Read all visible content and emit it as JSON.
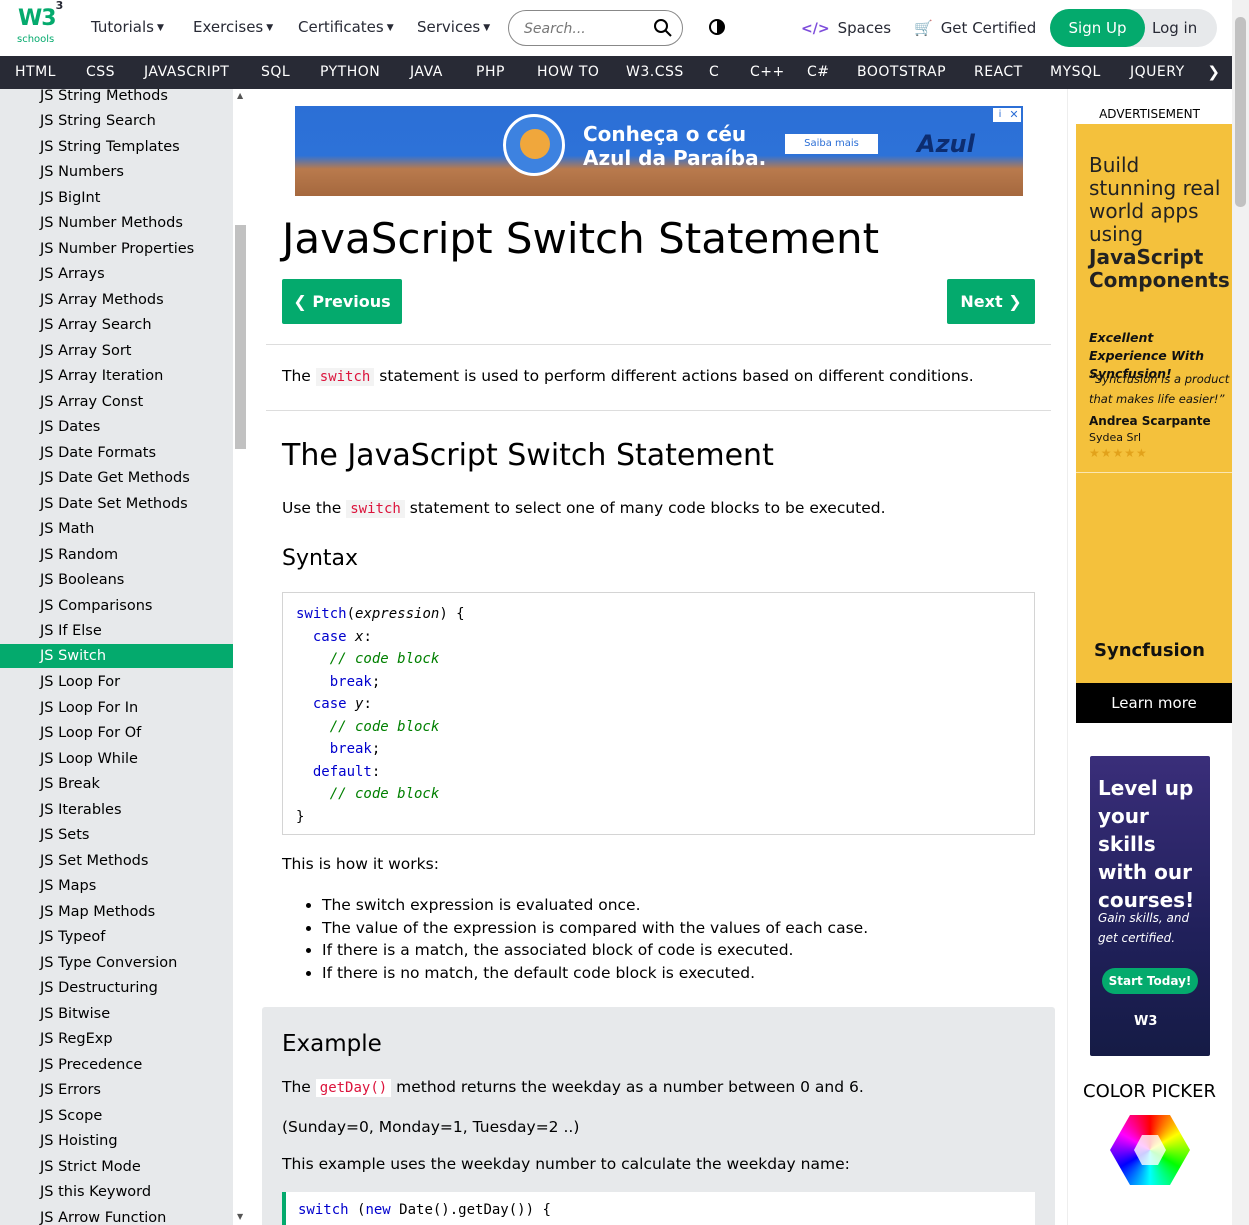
{
  "logo": {
    "brand": "W3",
    "sup": "3",
    "sub": "schools"
  },
  "topnav": {
    "tutorials": "Tutorials",
    "exercises": "Exercises",
    "certificates": "Certificates",
    "services": "Services",
    "search_placeholder": "Search...",
    "spaces": "Spaces",
    "get_certified": "Get Certified",
    "sign_up": "Sign Up",
    "log_in": "Log in"
  },
  "darknav": [
    "HTML",
    "CSS",
    "JAVASCRIPT",
    "SQL",
    "PYTHON",
    "JAVA",
    "PHP",
    "HOW TO",
    "W3.CSS",
    "C",
    "C++",
    "C#",
    "BOOTSTRAP",
    "REACT",
    "MYSQL",
    "JQUERY"
  ],
  "sidebar": {
    "items": [
      "JS String Methods",
      "JS String Search",
      "JS String Templates",
      "JS Numbers",
      "JS BigInt",
      "JS Number Methods",
      "JS Number Properties",
      "JS Arrays",
      "JS Array Methods",
      "JS Array Search",
      "JS Array Sort",
      "JS Array Iteration",
      "JS Array Const",
      "JS Dates",
      "JS Date Formats",
      "JS Date Get Methods",
      "JS Date Set Methods",
      "JS Math",
      "JS Random",
      "JS Booleans",
      "JS Comparisons",
      "JS If Else",
      "JS Switch",
      "JS Loop For",
      "JS Loop For In",
      "JS Loop For Of",
      "JS Loop While",
      "JS Break",
      "JS Iterables",
      "JS Sets",
      "JS Set Methods",
      "JS Maps",
      "JS Map Methods",
      "JS Typeof",
      "JS Type Conversion",
      "JS Destructuring",
      "JS Bitwise",
      "JS RegExp",
      "JS Precedence",
      "JS Errors",
      "JS Scope",
      "JS Hoisting",
      "JS Strict Mode",
      "JS this Keyword",
      "JS Arrow Function"
    ],
    "active": "JS Switch"
  },
  "ad_top": {
    "headline_1": "Conheça o céu",
    "headline_2": "Azul da Paraíba.",
    "button": "Saiba mais",
    "brand": "Azul"
  },
  "page": {
    "title": "JavaScript Switch Statement",
    "previous": "❮ Previous",
    "next": "Next ❯",
    "intro_pre": "The ",
    "intro_code": "switch",
    "intro_post": " statement is used to perform different actions based on different conditions.",
    "h2": "The JavaScript Switch Statement",
    "use_pre": "Use the ",
    "use_code": "switch",
    "use_post": " statement to select one of many code blocks to be executed.",
    "syntax_heading": "Syntax",
    "how_it_works": "This is how it works:",
    "bullets": [
      "The switch expression is evaluated once.",
      "The value of the expression is compared with the values of each case.",
      "If there is a match, the associated block of code is executed.",
      "If there is no match, the default code block is executed."
    ],
    "example": {
      "heading": "Example",
      "p1_pre": "The ",
      "p1_code": "getDay()",
      "p1_post": " method returns the weekday as a number between 0 and 6.",
      "p2": "(Sunday=0, Monday=1, Tuesday=2 ..)",
      "p3": "This example uses the weekday number to calculate the weekday name:",
      "code_kw1": "switch",
      "code_kw2": "new",
      "code_rest": " Date().getDay()) {"
    }
  },
  "right": {
    "ad_label": "ADVERTISEMENT",
    "sf_heading_1": "Build stunning real world apps using",
    "sf_heading_2": "JavaScript Components",
    "sf_quote_title": "Excellent Experience With Syncfusion!",
    "sf_quote": "“Syncfusion is a product that makes life easier!”",
    "sf_author": "Andrea Scarpante",
    "sf_company": "Sydea Srl",
    "sf_stars": "★★★★★",
    "sf_logo": "Syncfusion",
    "learn_more": "Learn more",
    "lvl_heading": "Level up your skills with our courses!",
    "lvl_sub": "Gain skills, and get certified.",
    "lvl_button": "Start Today!",
    "lvl_logo": "W3",
    "color_picker": "COLOR PICKER"
  }
}
